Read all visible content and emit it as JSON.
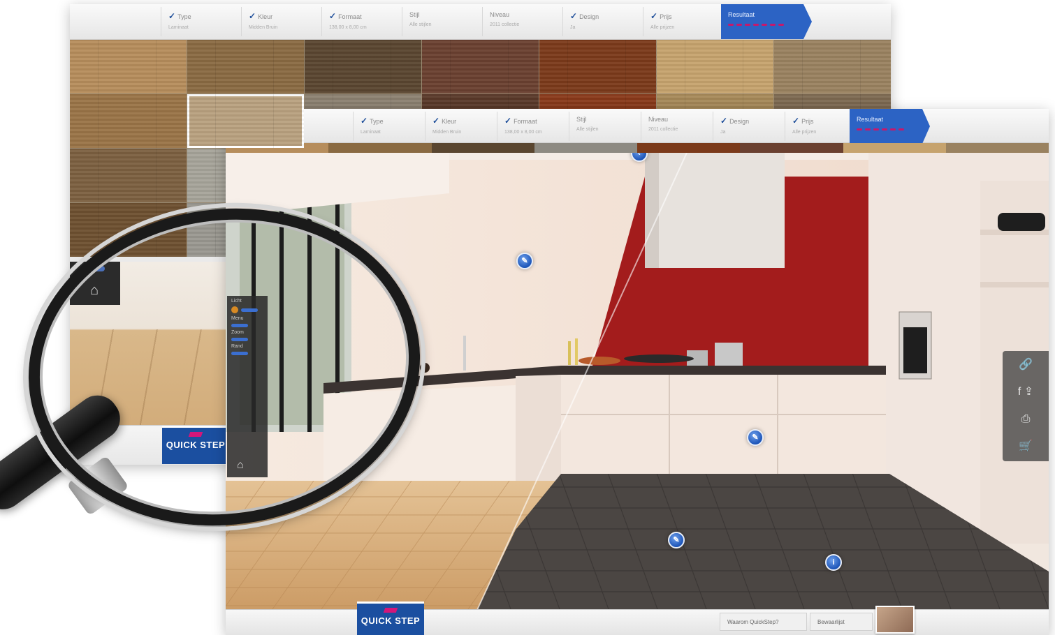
{
  "back_window": {
    "steps": [
      {
        "label": "Type",
        "sub": "Laminaat"
      },
      {
        "label": "Kleur",
        "sub": "Midden Bruin"
      },
      {
        "label": "Formaat",
        "sub": "138,00 x 8,00 cm"
      },
      {
        "label": "Stijl",
        "sub": "Alle stijlen"
      },
      {
        "label": "Niveau",
        "sub": "2011 collectie"
      },
      {
        "label": "Design",
        "sub": "Ja"
      },
      {
        "label": "Prijs",
        "sub": "Alle prijzen"
      }
    ],
    "final_step": "Resultaat",
    "logo_text": "QUICK STEP"
  },
  "front_window": {
    "steps": [
      {
        "label": "Type",
        "sub": "Laminaat"
      },
      {
        "label": "Kleur",
        "sub": "Midden Bruin"
      },
      {
        "label": "Formaat",
        "sub": "138,00 x 8,00 cm"
      },
      {
        "label": "Stijl",
        "sub": "Alle stijlen"
      },
      {
        "label": "Niveau",
        "sub": "2011 collectie"
      },
      {
        "label": "Design",
        "sub": "Ja"
      },
      {
        "label": "Prijs",
        "sub": "Alle prijzen"
      }
    ],
    "final_step": "Resultaat",
    "logo_text": "QUICK STEP",
    "footer_buttons": [
      "Waarom QuickStep?",
      "Bewaarlijst"
    ],
    "info_glyph": "i",
    "sidetools": [
      "link-icon",
      "share-icon",
      "print-icon",
      "cart-icon"
    ]
  },
  "magnifier_panel": {
    "labels": [
      "Licht",
      "Menu",
      "Zoom",
      "Rand"
    ]
  },
  "colors": {
    "accent_blue": "#1b4fa0",
    "accent_pink": "#d3167a",
    "wall_red": "#a31c1c",
    "floor_light": "#d4a877",
    "floor_dark": "#4b4643"
  }
}
